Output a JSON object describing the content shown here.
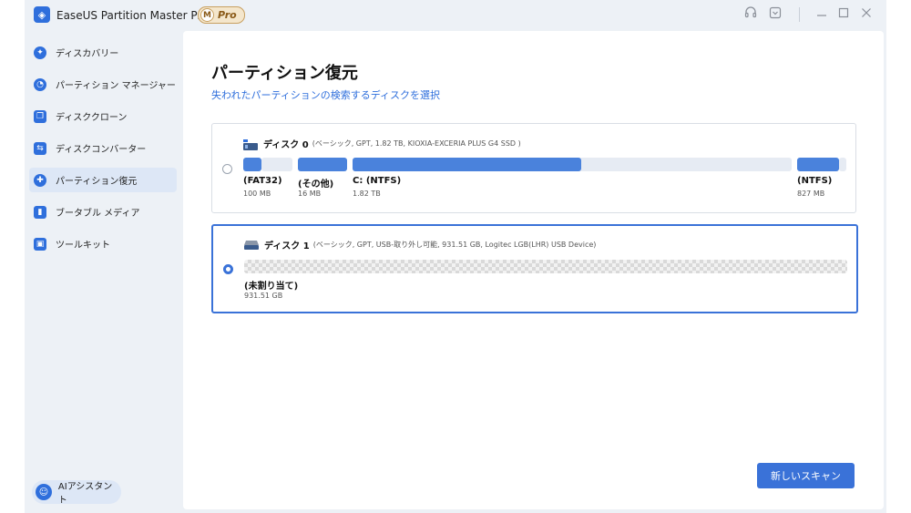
{
  "window": {
    "app_title": "EaseUS Partition Master Pro版",
    "badge_letter": "M",
    "badge_text": "Pro"
  },
  "sidebar": {
    "items": [
      {
        "label": "ディスカバリー",
        "icon": "compass-icon"
      },
      {
        "label": "パーティション マネージャー",
        "icon": "pie-chart-icon"
      },
      {
        "label": "ディスククローン",
        "icon": "clone-icon"
      },
      {
        "label": "ディスクコンバーター",
        "icon": "convert-icon"
      },
      {
        "label": "パーティション復元",
        "icon": "recovery-icon",
        "active": true
      },
      {
        "label": "ブータブル メディア",
        "icon": "usb-icon"
      },
      {
        "label": "ツールキット",
        "icon": "toolbox-icon"
      }
    ],
    "assistant_label": "AIアシスタント"
  },
  "main": {
    "title": "パーティション復元",
    "subtitle": "失われたパーティションの検索するディスクを選択",
    "disks": [
      {
        "name": "ディスク 0",
        "desc": "(ベーシック, GPT, 1.82 TB, KIOXIA-EXCERIA PLUS G4 SSD )",
        "selected": false,
        "partitions": [
          {
            "label": "(FAT32)",
            "size": "100 MB"
          },
          {
            "label": "(その他)",
            "size": "16 MB"
          },
          {
            "label": "C: (NTFS)",
            "size": "1.82 TB",
            "used_fraction": 0.52
          },
          {
            "label": "(NTFS)",
            "size": "827 MB"
          }
        ]
      },
      {
        "name": "ディスク 1",
        "desc": "(ベーシック, GPT, USB-取り外し可能, 931.51 GB, Logitec LGB(LHR) USB Device)",
        "selected": true,
        "partitions": [
          {
            "label": "(未割り当て)",
            "size": "931.51 GB"
          }
        ]
      }
    ],
    "scan_button": "新しいスキャン"
  },
  "colors": {
    "accent": "#3a72d8",
    "partition_used": "#4a82dc",
    "sidebar_bg": "#edf1f6",
    "active_item_bg": "#dde7f6"
  }
}
